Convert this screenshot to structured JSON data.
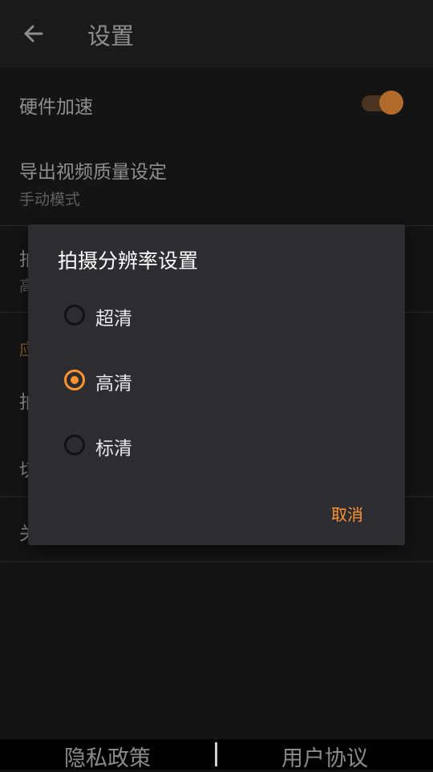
{
  "appbar": {
    "title": "设置",
    "back_icon": "arrow-left-icon"
  },
  "settings": {
    "hardware_accel": {
      "label": "硬件加速",
      "enabled": true
    },
    "export_quality": {
      "label": "导出视频质量设定",
      "value": "手动模式"
    },
    "row3": {
      "title": "拍",
      "sub": "高"
    },
    "section": {
      "title": "应"
    },
    "row4": {
      "title": "拍"
    },
    "row5": {
      "title": "切"
    },
    "row6": {
      "title": "关"
    }
  },
  "dialog": {
    "title": "拍摄分辨率设置",
    "options": [
      {
        "label": "超清",
        "selected": false
      },
      {
        "label": "高清",
        "selected": true
      },
      {
        "label": "标清",
        "selected": false
      }
    ],
    "cancel_label": "取消"
  },
  "footer": {
    "privacy": "隐私政策",
    "agreement": "用户协议"
  },
  "colors": {
    "accent": "#ff9530",
    "dialog_bg": "#2d2d31",
    "page_bg": "#141414"
  }
}
